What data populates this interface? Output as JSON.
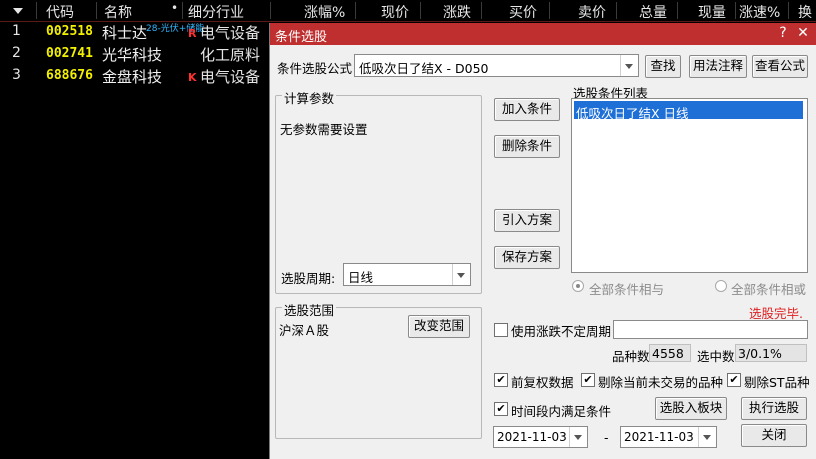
{
  "table": {
    "columns": [
      "代码",
      "名称",
      "细分行业",
      "涨幅%",
      "现价",
      "涨跌",
      "买价",
      "卖价",
      "总量",
      "现量",
      "涨速%",
      "换"
    ],
    "rows": [
      {
        "num": "1",
        "code": "002518",
        "name": "科士达",
        "mark": "R",
        "industry": "电气设备",
        "tag": "28-光伏+储能"
      },
      {
        "num": "2",
        "code": "002741",
        "name": "光华科技",
        "mark": "",
        "industry": "化工原料",
        "tag": ""
      },
      {
        "num": "3",
        "code": "688676",
        "name": "金盘科技",
        "mark": "K",
        "industry": "电气设备",
        "tag": ""
      }
    ]
  },
  "dialog": {
    "title": "条件选股",
    "formula_label": "条件选股公式",
    "formula_value": "低吸次日了结X - D050",
    "btn_find": "查找",
    "btn_usage": "用法注释",
    "btn_view": "查看公式",
    "params_group": "计算参数",
    "params_text": "无参数需要设置",
    "period_label": "选股周期:",
    "period_value": "日线",
    "btn_add": "加入条件",
    "btn_delete": "删除条件",
    "btn_import": "引入方案",
    "btn_save": "保存方案",
    "list_label": "选股条件列表",
    "list_items": [
      "低吸次日了结X  日线"
    ],
    "radio_and": "全部条件相与",
    "radio_or": "全部条件相或",
    "status": "选股完毕.",
    "range_group": "选股范围",
    "range_value": "沪深Ａ股",
    "btn_range": "改变范围",
    "use_period_label": "使用涨跌不定周期",
    "count_label": "品种数",
    "count_value": "4558",
    "selected_label": "选中数",
    "selected_value": "3/0.1%",
    "chk_fq": "前复权数据",
    "chk_remove_untraded": "剔除当前未交易的品种",
    "chk_remove_st": "剔除ST品种",
    "chk_time_range": "时间段内满足条件",
    "btn_to_block": "选股入板块",
    "btn_execute": "执行选股",
    "date_from": "2021-11-03",
    "date_sep": "-",
    "date_to": "2021-11-03",
    "btn_close": "关闭"
  },
  "colors": {
    "title_bar": "#bf2f2f",
    "selected_item": "#1e6fd6",
    "status_red": "#e02020",
    "code_yellow": "#f3f000"
  }
}
